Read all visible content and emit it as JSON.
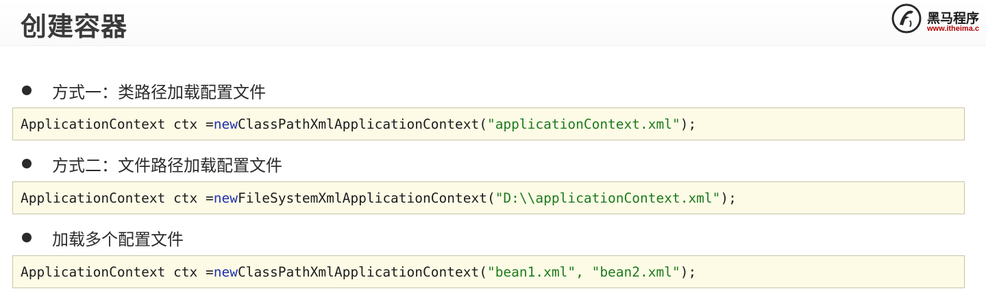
{
  "slide": {
    "title": "创建容器"
  },
  "logo": {
    "name": "黑马程序",
    "url": "www.itheima.c"
  },
  "sections": [
    {
      "bullet": "方式一：类路径加载配置文件",
      "code": {
        "pre": "ApplicationContext ctx = ",
        "keyword": "new",
        "mid": " ClassPathXmlApplicationContext(",
        "string": "\"applicationContext.xml\"",
        "post": ");"
      }
    },
    {
      "bullet": "方式二：文件路径加载配置文件",
      "code": {
        "pre": "ApplicationContext ctx = ",
        "keyword": "new",
        "mid": " FileSystemXmlApplicationContext(",
        "string": "\"D:\\\\applicationContext.xml\"",
        "post": ");"
      }
    },
    {
      "bullet": "加载多个配置文件",
      "code": {
        "pre": "ApplicationContext ctx = ",
        "keyword": "new",
        "mid": " ClassPathXmlApplicationContext(",
        "string": "\"bean1.xml\", \"bean2.xml\"",
        "post": ");"
      }
    }
  ],
  "colors": {
    "keyword": "#1f2fb0",
    "string": "#1e7a1e",
    "code_background": "#fdfbe6",
    "logo_url": "#b00000"
  },
  "icons": {
    "logo": "itheima-horse-logo-icon",
    "bullet": "bullet-dot-icon"
  }
}
